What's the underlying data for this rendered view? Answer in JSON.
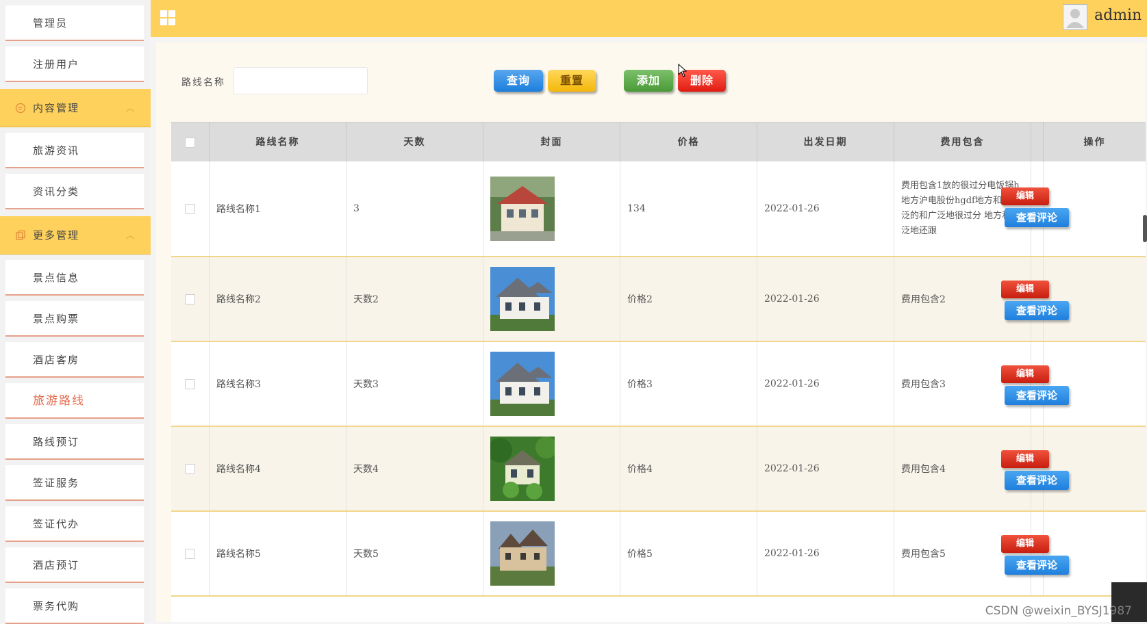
{
  "sidebar": {
    "items_top": [
      {
        "label": "管理员"
      },
      {
        "label": "注册用户"
      }
    ],
    "group1": {
      "label": "内容管理",
      "icon": "chat-icon"
    },
    "group1_items": [
      {
        "label": "旅游资讯"
      },
      {
        "label": "资讯分类"
      }
    ],
    "group2": {
      "label": "更多管理",
      "icon": "copy-icon"
    },
    "group2_items": [
      {
        "label": "景点信息"
      },
      {
        "label": "景点购票"
      },
      {
        "label": "酒店客房"
      },
      {
        "label": "旅游路线",
        "active": true
      },
      {
        "label": "路线预订"
      },
      {
        "label": "签证服务"
      },
      {
        "label": "签证代办"
      },
      {
        "label": "酒店预订"
      },
      {
        "label": "票务代购"
      }
    ]
  },
  "header": {
    "username": "admin",
    "color": "#fdd15c"
  },
  "search": {
    "label": "路线名称",
    "value": "",
    "placeholder": ""
  },
  "buttons": {
    "query": "查询",
    "reset": "重置",
    "add": "添加",
    "delete": "删除"
  },
  "table": {
    "headers": [
      "路线名称",
      "天数",
      "封面",
      "价格",
      "出发日期",
      "费用包含",
      "操作"
    ],
    "rows": [
      {
        "name": "路线名称1",
        "days": "3",
        "price": "134",
        "date": "2022-01-26",
        "fee": "费用包含1放的很过分电饭锅h地方沪电股份hgdf地方和更广泛的和广泛地很过分 地方和广泛地还跟",
        "extra": "onf"
      },
      {
        "name": "路线名称2",
        "days": "天数2",
        "price": "价格2",
        "date": "2022-01-26",
        "fee": "费用包含2",
        "extra": "onf"
      },
      {
        "name": "路线名称3",
        "days": "天数3",
        "price": "价格3",
        "date": "2022-01-26",
        "fee": "费用包含3",
        "extra": "onf"
      },
      {
        "name": "路线名称4",
        "days": "天数4",
        "price": "价格4",
        "date": "2022-01-26",
        "fee": "费用包含4",
        "extra": "onf"
      },
      {
        "name": "路线名称5",
        "days": "天数5",
        "price": "价格5",
        "date": "2022-01-26",
        "fee": "费用包含5",
        "extra": "onf"
      }
    ],
    "actions": {
      "edit": "编辑",
      "view": "查看评论"
    }
  },
  "watermark": "CSDN @weixin_BYSJ1987"
}
